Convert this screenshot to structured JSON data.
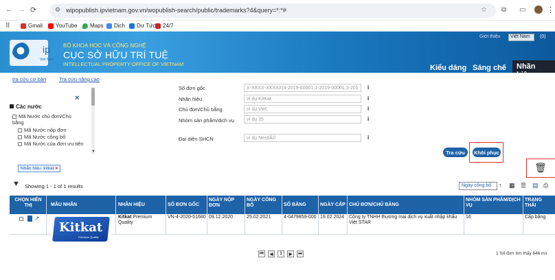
{
  "browser": {
    "url": "wipopublish.ipvietnam.gov.vn/wopublish-search/public/trademarks?4&query=*:*#",
    "bookmarks": [
      "Gmail",
      "YouTube",
      "Maps",
      "Dịch",
      "Dư Tức",
      "24/7"
    ],
    "apps_label": "⠿"
  },
  "banner": {
    "ministry": "BỘ KHOA HỌC VÀ CÔNG NGHỆ",
    "office": "CỤC SỞ HỮU TRÍ TUỆ",
    "office_en": "INTELLECTUAL PROPERTY OFFICE OF VIETNAM",
    "logo_text": "ip",
    "logo_sub": "Viet Nam",
    "intro": "Giới thiệu",
    "language": "Việt Nam",
    "cart": "(0)",
    "tabs": [
      "Kiểu dáng",
      "Sáng chế",
      "Nhãn hiệu"
    ]
  },
  "search": {
    "basic_link": "tra cứu cơ bản",
    "advanced_link": "Tra cứu nâng cao",
    "close": "×",
    "countries_heading": "Các nước",
    "countries": [
      "Mã Nước chủ đơn/Chủ bằng",
      "Mã Nước nộp đơn",
      "Mã Nước công bố",
      "Mã Nước của đơn ưu tiên"
    ],
    "fields": [
      {
        "label": "Số đơn gốc",
        "placeholder": "X-XXXX-XXXXX(4-2019-00001,1-2019-00001,3-201"
      },
      {
        "label": "Nhãn hiệu",
        "placeholder": "ví dụ KitKat"
      },
      {
        "label": "Chủ đơn/Chủ bằng",
        "placeholder": "ví dụ Viet,"
      },
      {
        "label": "Nhóm sản phẩm/dịch vụ",
        "placeholder": "ví dụ 35"
      },
      {
        "label": "Đại diện SHCN",
        "placeholder": "ví dụ NestlÃ©"
      }
    ],
    "search_btn": "Tra cứu",
    "reset_btn": "Khôi phục",
    "chip": "Nhãn hiệu: kitkat"
  },
  "results": {
    "showing": "Showing 1 - 1 of 1 results",
    "sort": "Ngày công bố",
    "columns": [
      "CHỌN HIỂN THỊ",
      "MẪU NHÃN",
      "NHÃN HIỆU",
      "SỐ ĐƠN GỐC",
      "NGÀY NỘP ĐƠN",
      "NGÀY CÔNG BỐ",
      "SỐ BẰNG",
      "NGÀY CẤP",
      "CHỦ ĐƠN/CHỦ BẰNG",
      "NHÓM SẢN PHẨM/DỊCH VỤ",
      "TRẠNG THÁI"
    ],
    "row": {
      "brand_bold": "Kitkat",
      "brand_rest": "Premium Quality",
      "logo_text": "Kitkat",
      "logo_sub": "Premium Quality",
      "app_no": "VN-4-2020-51680",
      "filing_date": "09.12.2020",
      "pub_date": "25.02.2021",
      "reg_no": "4-0479859-000",
      "grant_date": "19.02.2024",
      "owner": "Công ty TNHH thương mại dịch vụ xuất nhập khẩu Việt STAR",
      "classes": "16",
      "status": "Cấp bằng"
    },
    "pages": [
      "⏮",
      "◀",
      "1",
      "▶",
      "⏭"
    ],
    "timing": "1 Số đơn tìm thấy 646 ms"
  }
}
